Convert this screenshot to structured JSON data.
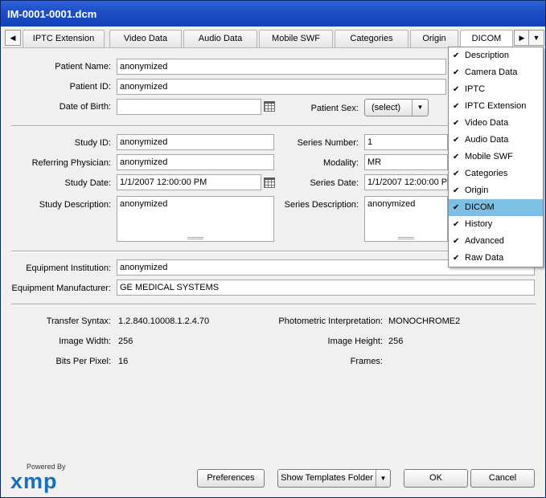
{
  "window": {
    "title": "IM-0001-0001.dcm"
  },
  "tabs": [
    {
      "label": "IPTC Extension"
    },
    {
      "label": "Video Data"
    },
    {
      "label": "Audio Data"
    },
    {
      "label": "Mobile SWF"
    },
    {
      "label": "Categories"
    },
    {
      "label": "Origin"
    },
    {
      "label": "DICOM"
    }
  ],
  "patient": {
    "name_label": "Patient Name:",
    "name_value": "anonymized",
    "id_label": "Patient ID:",
    "id_value": "anonymized",
    "dob_label": "Date of Birth:",
    "dob_value": "",
    "sex_label": "Patient Sex:",
    "sex_value": "(select)"
  },
  "study": {
    "id_label": "Study ID:",
    "id_value": "anonymized",
    "ref_label": "Referring Physician:",
    "ref_value": "anonymized",
    "date_label": "Study Date:",
    "date_value": "1/1/2007 12:00:00 PM",
    "desc_label": "Study Description:",
    "desc_value": "anonymized",
    "series_number_label": "Series Number:",
    "series_number_value": "1",
    "modality_label": "Modality:",
    "modality_value": "MR",
    "series_date_label": "Series Date:",
    "series_date_value": "1/1/2007 12:00:00 PM",
    "series_desc_label": "Series Description:",
    "series_desc_value": "anonymized"
  },
  "equipment": {
    "inst_label": "Equipment Institution:",
    "inst_value": "anonymized",
    "manu_label": "Equipment Manufacturer:",
    "manu_value": "GE MEDICAL SYSTEMS"
  },
  "image": {
    "syntax_label": "Transfer Syntax:",
    "syntax_value": "1.2.840.10008.1.2.4.70",
    "photo_label": "Photometric Interpretation:",
    "photo_value": "MONOCHROME2",
    "width_label": "Image Width:",
    "width_value": "256",
    "height_label": "Image Height:",
    "height_value": "256",
    "bits_label": "Bits Per Pixel:",
    "bits_value": "16",
    "frames_label": "Frames:",
    "frames_value": ""
  },
  "footer": {
    "powered": "Powered By",
    "logo": "xmp",
    "prefs": "Preferences",
    "templates": "Show Templates Folder",
    "ok": "OK",
    "cancel": "Cancel"
  },
  "menu": {
    "items": [
      {
        "label": "Description",
        "check": "✔"
      },
      {
        "label": "Camera Data",
        "check": "✔"
      },
      {
        "label": "IPTC",
        "check": "✔"
      },
      {
        "label": "IPTC Extension",
        "check": "✔"
      },
      {
        "label": "Video Data",
        "check": "✔"
      },
      {
        "label": "Audio Data",
        "check": "✔"
      },
      {
        "label": "Mobile SWF",
        "check": "✔"
      },
      {
        "label": "Categories",
        "check": "✔"
      },
      {
        "label": "Origin",
        "check": "✔"
      },
      {
        "label": "DICOM",
        "check": "✔"
      },
      {
        "label": "History",
        "check": "✔"
      },
      {
        "label": "Advanced",
        "check": "✔"
      },
      {
        "label": "Raw Data",
        "check": "✔"
      }
    ],
    "highlight_color": "#7ec0e4"
  }
}
